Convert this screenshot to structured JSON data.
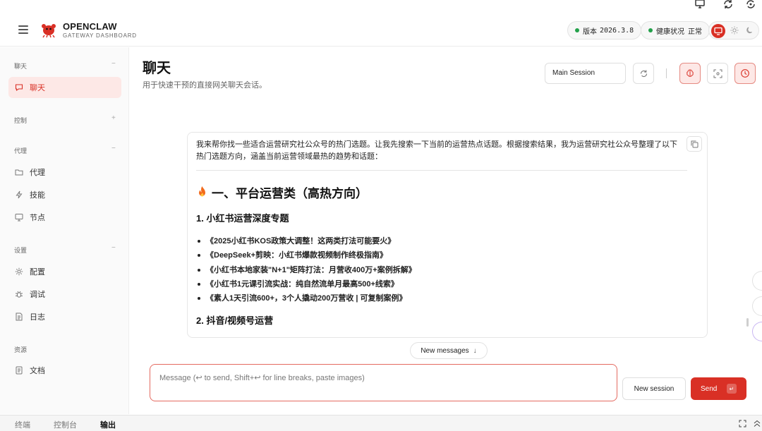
{
  "app": {
    "brand_name": "OPENCLAW",
    "brand_sub": "GATEWAY DASHBOARD"
  },
  "status": {
    "version_label": "版本",
    "version_value": "2026.3.8",
    "health_label": "健康状况",
    "health_value": "正常",
    "ok_color": "#22a04a"
  },
  "sidebar": {
    "sections": [
      {
        "title": "聊天",
        "toggle": "−",
        "items": [
          {
            "label": "聊天",
            "icon": "chat-bubble-icon",
            "active": true
          }
        ]
      },
      {
        "title": "控制",
        "toggle": "+",
        "items": []
      },
      {
        "title": "代理",
        "toggle": "−",
        "items": [
          {
            "label": "代理",
            "icon": "folder-icon"
          },
          {
            "label": "技能",
            "icon": "bolt-icon"
          },
          {
            "label": "节点",
            "icon": "monitor-icon"
          }
        ]
      },
      {
        "title": "设置",
        "toggle": "−",
        "items": [
          {
            "label": "配置",
            "icon": "gear-icon"
          },
          {
            "label": "调试",
            "icon": "bug-icon"
          },
          {
            "label": "日志",
            "icon": "log-icon"
          }
        ]
      },
      {
        "title": "资源",
        "toggle": "",
        "items": [
          {
            "label": "文档",
            "icon": "document-icon"
          }
        ]
      }
    ]
  },
  "main": {
    "title": "聊天",
    "subtitle": "用于快速干预的直接网关聊天会话。",
    "session_select": "Main Session"
  },
  "message": {
    "intro": "我来帮你找一些适合运营研究社公众号的热门选题。让我先搜索一下当前的运营热点话题。根据搜索结果，我为运营研究社公众号整理了以下热门选题方向，涵盖当前运营领域最热的趋势和话题：",
    "heading": "一、平台运营类（高热方向）",
    "sub1": "1. 小红书运营深度专题",
    "bullets": [
      "《2025小红书KOS政策大调整！这两类打法可能要火》",
      "《DeepSeek+剪映：小红书爆款视频制作终极指南》",
      "《小红书本地家装\"N+1\"矩阵打法：月营收400万+案例拆解》",
      "《小红书1元课引流实战：纯自然流单月最高500+线索》",
      "《素人1天引流600+，3个人撬动200万营收 | 可复制案例》"
    ],
    "sub2": "2. 抖音/视频号运营"
  },
  "composer": {
    "new_messages": "New messages",
    "placeholder": "Message (↩ to send, Shift+↩ for line breaks, paste images)",
    "new_session": "New session",
    "send": "Send",
    "send_kbd": "↵"
  },
  "bottom_tabs": [
    {
      "label": "终端",
      "active": false
    },
    {
      "label": "控制台",
      "active": false
    },
    {
      "label": "输出",
      "active": true
    }
  ],
  "colors": {
    "accent": "#d93025",
    "accent_soft": "#fde8e6"
  }
}
